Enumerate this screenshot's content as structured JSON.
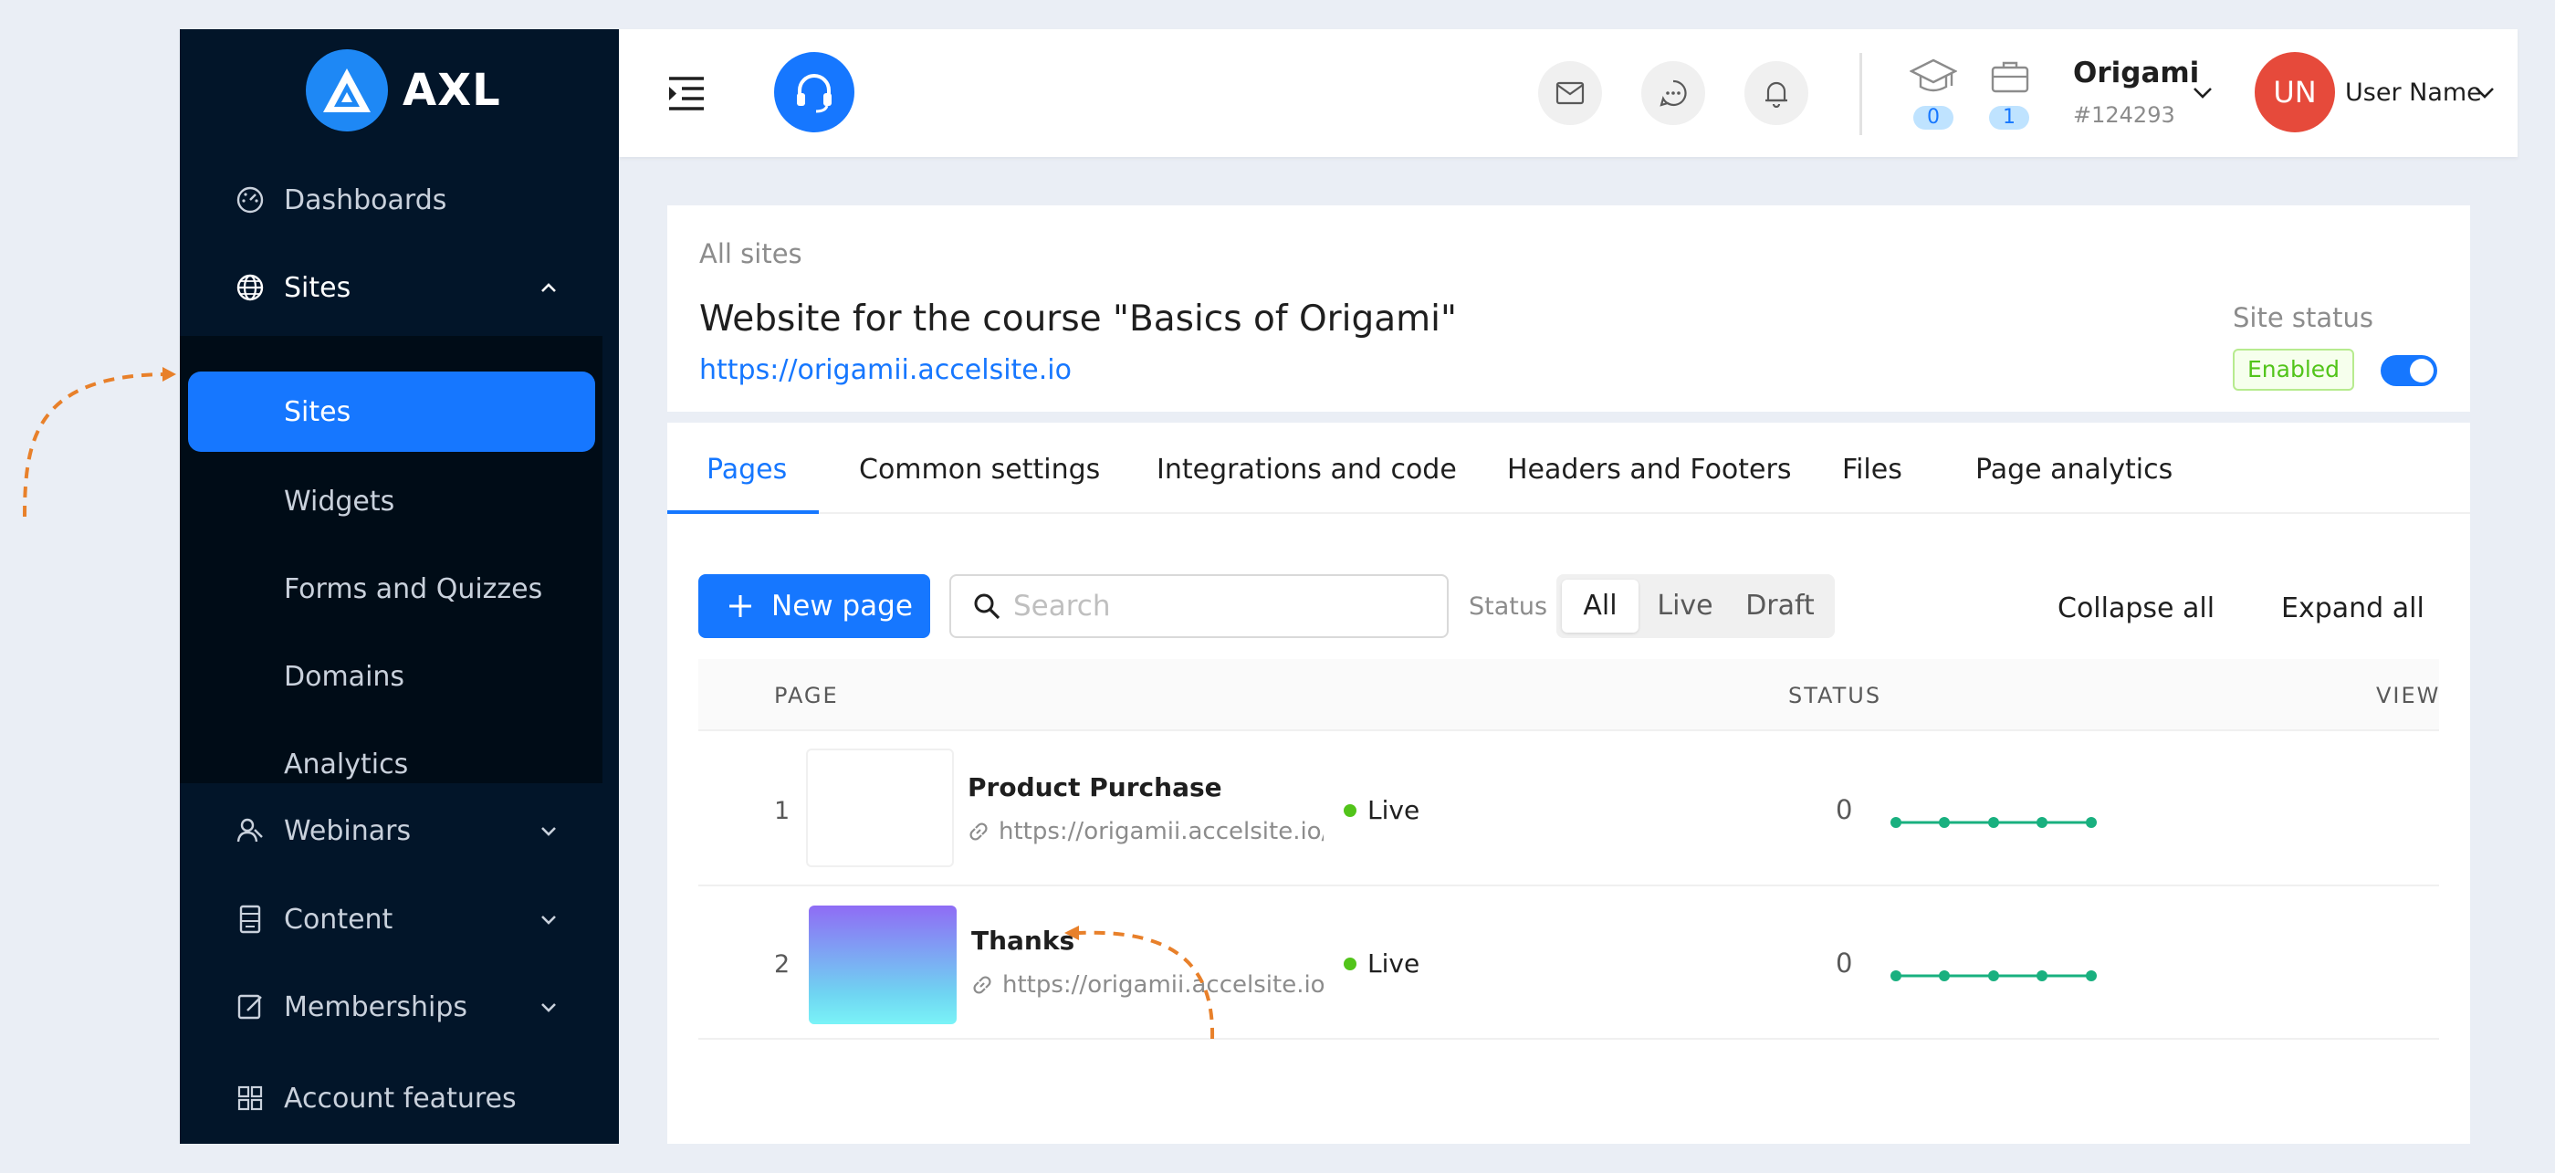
{
  "brand": {
    "name": "AXL",
    "logo_icon": "axl-triangle-logo",
    "accent": "#1677ff"
  },
  "sidebar": {
    "items": [
      {
        "label": "Dashboards",
        "icon": "dashboard-gauge-icon"
      },
      {
        "label": "Sites",
        "icon": "globe-icon",
        "expanded": true
      },
      {
        "label": "Webinars",
        "icon": "user-webinar-icon"
      },
      {
        "label": "Content",
        "icon": "document-content-icon"
      },
      {
        "label": "Memberships",
        "icon": "edit-membership-icon"
      },
      {
        "label": "Account features",
        "icon": "grid-icon"
      }
    ],
    "sites_submenu": [
      "Sites",
      "Widgets",
      "Forms and Quizzes",
      "Domains",
      "Analytics"
    ],
    "active_submenu": "Sites"
  },
  "header": {
    "menu_icon": "menu-fold-icon",
    "support_icon": "headset-icon",
    "actions": [
      "mail-icon",
      "chat-icon",
      "bell-icon"
    ],
    "counters": [
      {
        "icon": "graduation-cap-icon",
        "count": "0"
      },
      {
        "icon": "briefcase-icon",
        "count": "1"
      }
    ],
    "org": {
      "name": "Origami",
      "id": "#124293"
    },
    "user": {
      "initials": "UN",
      "name": "User Name",
      "avatar_color": "#e64a3b"
    }
  },
  "site": {
    "breadcrumb": "All sites",
    "title": "Website for the course \"Basics of Origami\"",
    "url": "https://origamii.accelsite.io",
    "status_label": "Site status",
    "status_tag": "Enabled",
    "status_enabled": true
  },
  "tabs": [
    "Pages",
    "Common settings",
    "Integrations and code",
    "Headers and Footers",
    "Files",
    "Page analytics"
  ],
  "active_tab": "Pages",
  "toolbar": {
    "new_page_label": "New page",
    "search_placeholder": "Search",
    "status_label": "Status",
    "status_options": [
      "All",
      "Live",
      "Draft"
    ],
    "selected_status": "All",
    "collapse_label": "Collapse all",
    "expand_label": "Expand all"
  },
  "table": {
    "columns": [
      "PAGE",
      "STATUS",
      "VIEWS"
    ],
    "rows": [
      {
        "num": "1",
        "name": "Product Purchase",
        "url": "https://origamii.accelsite.io/buy",
        "status": "Live",
        "views": "0",
        "thumb": "blank"
      },
      {
        "num": "2",
        "name": "Thanks",
        "url": "https://origamii.accelsite.io/thanks",
        "status": "Live",
        "views": "0",
        "thumb": "gradient"
      }
    ]
  },
  "colors": {
    "sidebar_bg": "#021529",
    "submenu_bg": "#000c17",
    "live_dot": "#52c41a",
    "spark": "#19b07f",
    "annotation": "#e8802a"
  }
}
